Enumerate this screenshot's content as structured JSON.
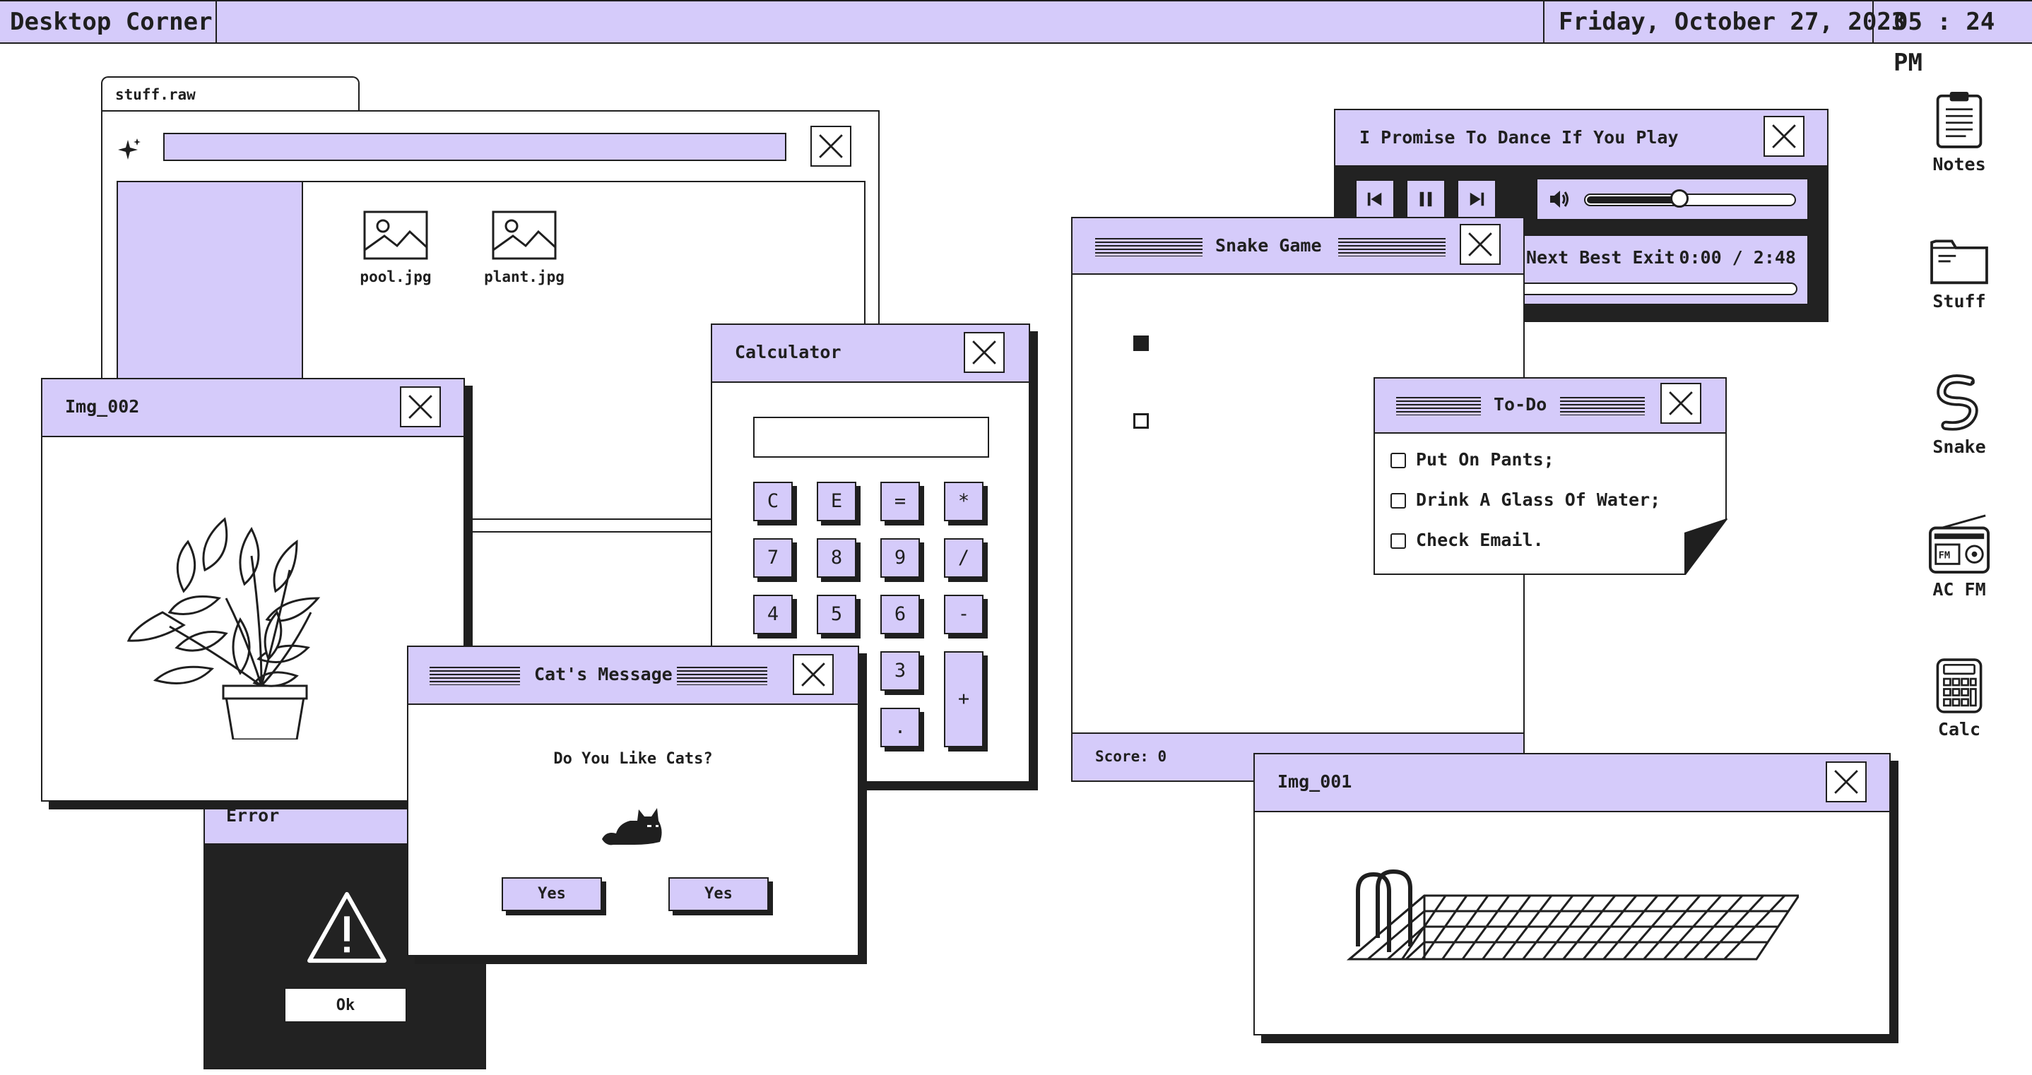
{
  "topbar": {
    "app_name": "Desktop Corner",
    "date": "Friday, October 27, 2023",
    "time": "05 : 24 PM"
  },
  "file_window": {
    "tab_label": "stuff.raw",
    "files": [
      {
        "name": "pool.jpg",
        "icon": "image-icon"
      },
      {
        "name": "plant.jpg",
        "icon": "image-icon"
      }
    ]
  },
  "music_player": {
    "title": "I Promise To Dance If You Play",
    "track": "Next Best Exit",
    "time": "0:00 / 2:48",
    "volume": 0.45,
    "progress": 0.0
  },
  "snake_game": {
    "title": "Snake Game",
    "score_label": "Score: 0"
  },
  "calculator": {
    "title": "Calculator",
    "display_value": "",
    "keys": [
      "C",
      "E",
      "=",
      "*",
      "7",
      "8",
      "9",
      "/",
      "4",
      "5",
      "6",
      "-",
      "3",
      ".",
      "+"
    ]
  },
  "todo": {
    "title": "To-Do",
    "items": [
      {
        "label": "Put On Pants;",
        "checked": false
      },
      {
        "label": "Drink A Glass Of Water;",
        "checked": false
      },
      {
        "label": "Check Email.",
        "checked": false
      }
    ]
  },
  "img_002": {
    "title": "Img_002"
  },
  "img_001": {
    "title": "Img_001"
  },
  "error_window": {
    "title": "Error",
    "ok_label": "Ok"
  },
  "cat_dialog": {
    "title": "Cat's Message",
    "question": "Do You Like Cats?",
    "yes1": "Yes",
    "yes2": "Yes"
  },
  "desktop_icons": [
    {
      "label": "Notes",
      "icon": "clipboard-icon"
    },
    {
      "label": "Stuff",
      "icon": "folder-icon"
    },
    {
      "label": "Snake",
      "icon": "snake-icon"
    },
    {
      "label": "AC FM",
      "icon": "radio-icon"
    },
    {
      "label": "Calc",
      "icon": "calculator-icon"
    }
  ],
  "colors": {
    "accent": "#d5cbfa",
    "ink": "#1f1f1f",
    "background": "#ffffff"
  }
}
